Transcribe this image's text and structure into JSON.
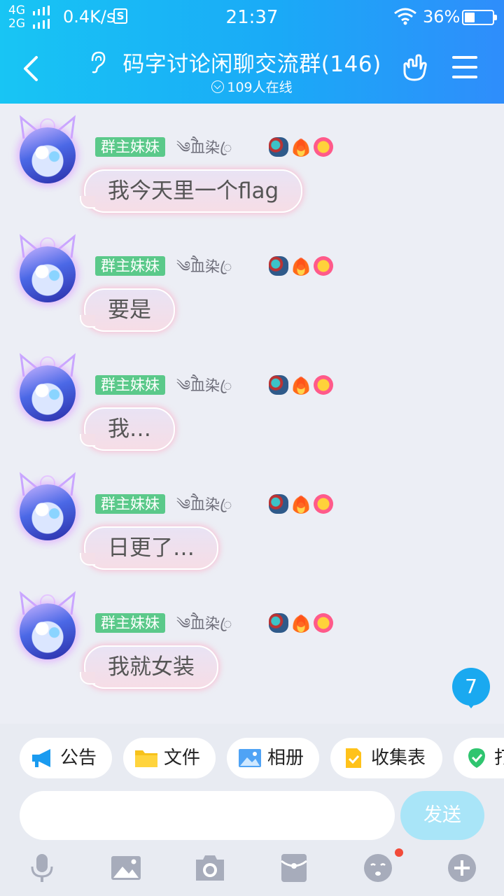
{
  "status_bar": {
    "network_top": "4G",
    "network_bottom": "2G",
    "speed": "0.4K/s",
    "s_badge": "S",
    "time": "21:37",
    "battery_pct": "36%",
    "battery_level": 0.36
  },
  "header": {
    "title": "码字讨论闲聊交流群(146)",
    "online": "109人在线"
  },
  "messages": [
    {
      "tag": "群主妹妹",
      "nick": "༄ཻ血染ꦿ",
      "text": "我今天里一个flag"
    },
    {
      "tag": "群主妹妹",
      "nick": "༄ཻ血染ꦿ",
      "text": "要是"
    },
    {
      "tag": "群主妹妹",
      "nick": "༄ཻ血染ꦿ",
      "text": "我…"
    },
    {
      "tag": "群主妹妹",
      "nick": "༄ཻ血染ꦿ",
      "text": "日更了…"
    },
    {
      "tag": "群主妹妹",
      "nick": "༄ཻ血染ꦿ",
      "text": "我就女装"
    }
  ],
  "unread_count": "7",
  "quick_actions": [
    {
      "label": "公告",
      "icon": "megaphone-icon"
    },
    {
      "label": "文件",
      "icon": "folder-icon"
    },
    {
      "label": "相册",
      "icon": "photo-album-icon"
    },
    {
      "label": "收集表",
      "icon": "form-icon"
    },
    {
      "label": "打",
      "icon": "shield-check-icon"
    }
  ],
  "input": {
    "placeholder": "",
    "send_label": "发送"
  },
  "colors": {
    "header_start": "#18c5f4",
    "header_end": "#2f8dfb",
    "tag_green": "#5bc98a",
    "badge_blue": "#1aa9f0",
    "send_disabled": "#a9e5f8"
  }
}
